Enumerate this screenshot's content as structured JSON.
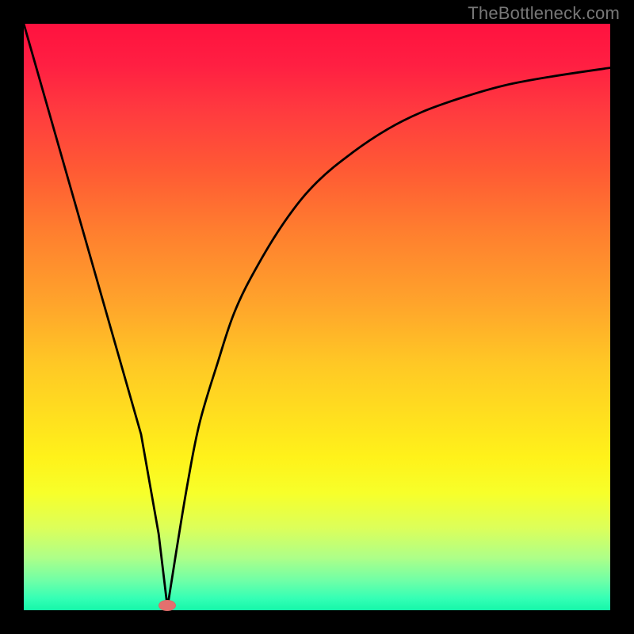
{
  "watermark": "TheBottleneck.com",
  "chart_data": {
    "type": "line",
    "title": "",
    "xlabel": "",
    "ylabel": "",
    "xlim": [
      0,
      100
    ],
    "ylim": [
      0,
      100
    ],
    "grid": false,
    "legend": false,
    "series": [
      {
        "name": "bottleneck-curve",
        "x": [
          0,
          4,
          8,
          12,
          16,
          20,
          23,
          24.5,
          26,
          28,
          30,
          33,
          36,
          40,
          45,
          50,
          56,
          62,
          68,
          75,
          82,
          90,
          100
        ],
        "y": [
          100,
          86,
          72,
          58,
          44,
          30,
          13,
          0.5,
          10,
          22,
          32,
          42,
          51,
          59,
          67,
          73,
          78,
          82,
          85,
          87.5,
          89.5,
          91,
          92.5
        ],
        "marker": {
          "x": 24.5,
          "y": 0.8
        }
      }
    ],
    "background_gradient": {
      "top": "#ff123f",
      "bottom": "#16f7a9"
    },
    "frame_color": "#000000"
  }
}
